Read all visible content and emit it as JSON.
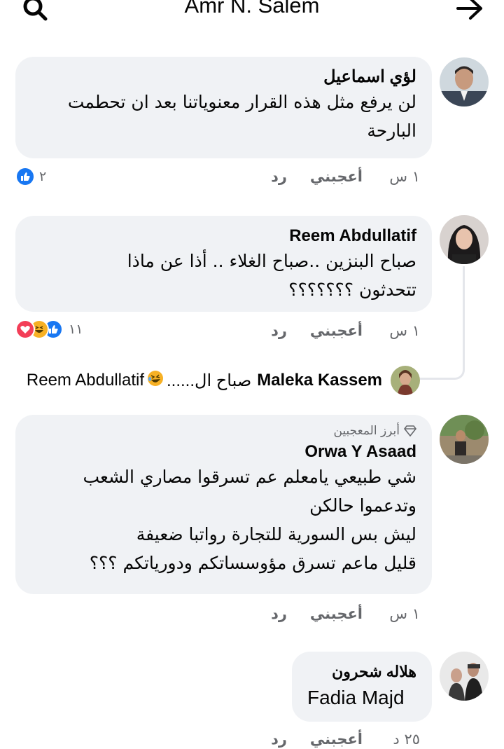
{
  "header": {
    "title": "Amr N. Salem"
  },
  "comments": [
    {
      "author": "لؤي اسماعيل",
      "text_lines": [
        "لن يرفع مثل هذه القرار معنوياتنا بعد ان تحطمت",
        "البارحة"
      ],
      "time": "١ س",
      "like_label": "أعجبني",
      "reply_label": "رد",
      "reaction_count": "٢",
      "reactions": [
        "like-icon"
      ]
    },
    {
      "author": "Reem Abdullatif",
      "text_lines": [
        "صباح البنزين ..صباح الغلاء .. أذا عن ماذا",
        "تتحدثون ؟؟؟؟؟؟؟"
      ],
      "time": "١ س",
      "like_label": "أعجبني",
      "reply_label": "رد",
      "reaction_count": "١١",
      "reactions": [
        "love-icon",
        "haha-icon",
        "like-icon"
      ],
      "reply_preview": {
        "author": "Maleka Kassem",
        "text": "صباح ال......",
        "mention": "Reem Abdullatif"
      }
    },
    {
      "badge": "أبرز المعجبين",
      "author": "Orwa Y Asaad",
      "text_lines": [
        "شي طبيعي يامعلم  عم تسرقوا مصاري الشعب",
        "وتدعموا حالكن",
        "ليش بس السورية للتجارة رواتبا ضعيفة",
        "قليل ماعم تسرق مؤوسساتكم ودورياتكم ؟؟؟"
      ],
      "time": "١ س",
      "like_label": "أعجبني",
      "reply_label": "رد"
    },
    {
      "author": "هلاله شحرون",
      "text_lines": [
        "Fadia Majd"
      ],
      "time": "٢٥ د",
      "like_label": "أعجبني",
      "reply_label": "رد"
    }
  ],
  "colors": {
    "bubble": "#f0f2f5",
    "like_blue": "#1877f2",
    "love_red": "#f33e58",
    "haha_yellow": "#f7b125",
    "meta_gray": "#65676b"
  }
}
